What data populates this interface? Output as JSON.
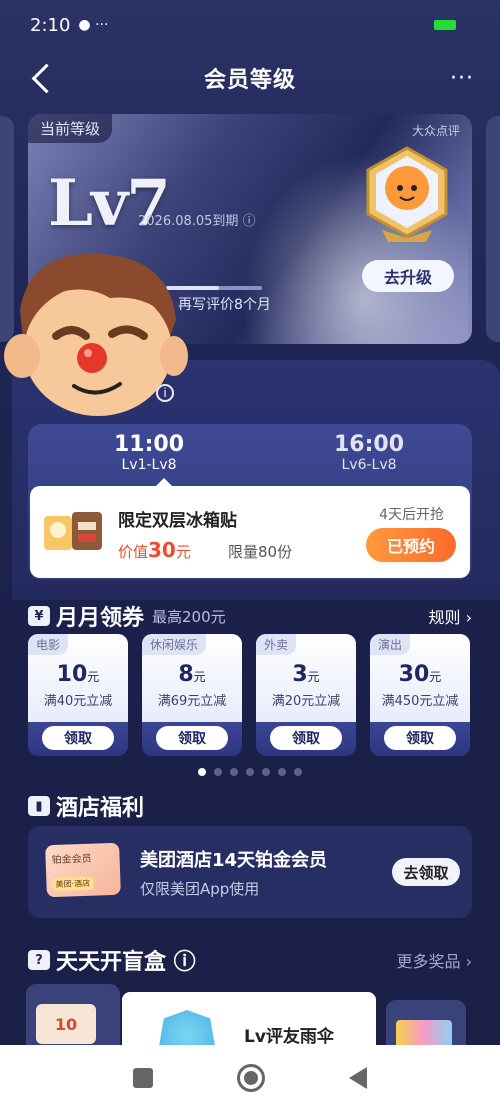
{
  "status": {
    "time": "2:10",
    "extra": "● ···"
  },
  "header": {
    "title": "会员等级",
    "more": "···"
  },
  "level_card": {
    "tag": "当前等级",
    "brand": "大众点评",
    "level": "Lv7",
    "expire": "2026.08.05到期 ⓘ",
    "tip": "再写评价8个月",
    "progress_fraction": 0.55,
    "upgrade_label": "去升级"
  },
  "schedule": {
    "slots": [
      {
        "time": "11:00",
        "range": "Lv1-Lv8"
      },
      {
        "time": "16:00",
        "range": "Lv6-Lv8"
      }
    ],
    "deal": {
      "name": "限定双层冰箱贴",
      "value_prefix": "价值",
      "value_num": "30",
      "value_unit": "元",
      "limit": "限量80份",
      "countdown": "4天后开抢",
      "book_label": "已预约"
    }
  },
  "monthly": {
    "title": "月月领券",
    "sub": "最高200元",
    "rules": "规则 ›",
    "coupons": [
      {
        "cat": "电影",
        "amt": "10",
        "unit": "元",
        "cond": "满40元立减",
        "btn": "领取"
      },
      {
        "cat": "休闲娱乐",
        "amt": "8",
        "unit": "元",
        "cond": "满69元立减",
        "btn": "领取"
      },
      {
        "cat": "外卖",
        "amt": "3",
        "unit": "元",
        "cond": "满20元立减",
        "btn": "领取"
      },
      {
        "cat": "演出",
        "amt": "30",
        "unit": "元",
        "cond": "满450元立减",
        "btn": "领取"
      }
    ]
  },
  "hotel": {
    "title": "酒店福利",
    "card_top": "铂金会员",
    "card_bottom": "美团·酒店",
    "name": "美团酒店14天铂金会员",
    "sub": "仅限美团App使用",
    "claim": "去领取"
  },
  "blindbox": {
    "title": "天天开盲盒 ⓘ",
    "more": "更多奖品 ›",
    "left_img": "10",
    "center_name": "Lv评友雨伞"
  },
  "colors": {
    "accent": "#ff6a2c",
    "bg": "#1f2654",
    "card": "#3f4a96"
  }
}
